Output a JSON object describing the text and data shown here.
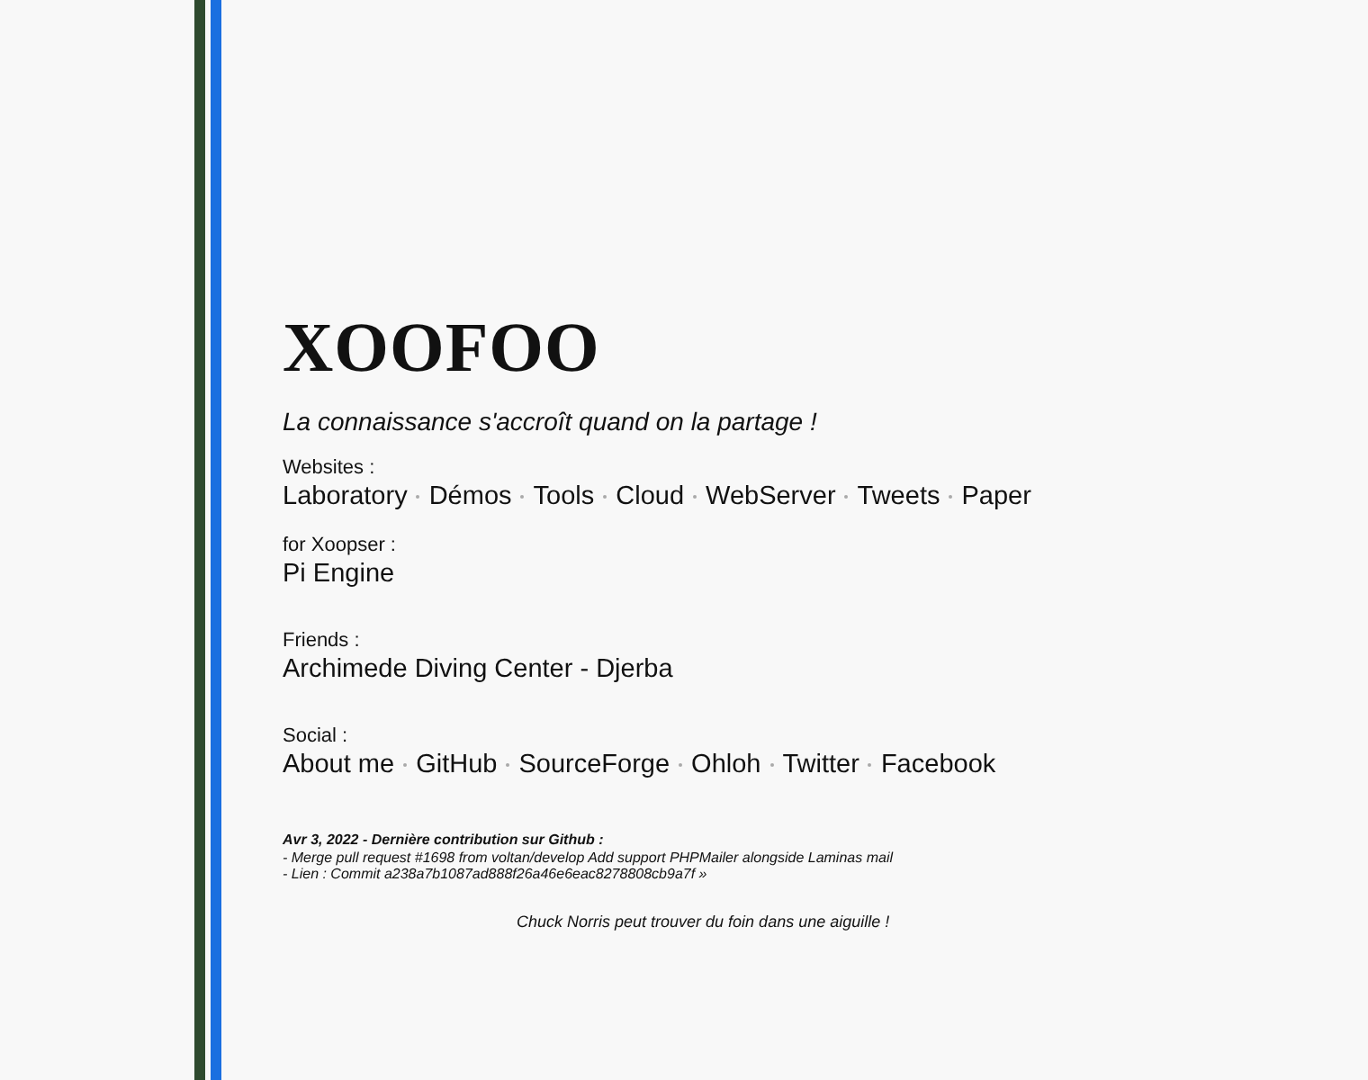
{
  "title": "XOOFOO",
  "tagline": "La connaissance s'accroît quand on la partage !",
  "sections": [
    {
      "label": "Websites :",
      "links": [
        "Laboratory",
        "Démos",
        "Tools",
        "Cloud",
        "WebServer",
        "Tweets",
        "Paper"
      ]
    },
    {
      "label": "for Xoopser :",
      "links": [
        "Pi Engine"
      ]
    },
    {
      "label": "Friends :",
      "links": [
        "Archimede Diving Center - Djerba"
      ]
    },
    {
      "label": "Social :",
      "links": [
        "About me",
        "GitHub",
        "SourceForge",
        "Ohloh",
        "Twitter",
        "Facebook"
      ]
    }
  ],
  "contribution": {
    "heading": "Avr 3, 2022 - Dernière contribution sur Github :",
    "lines": [
      "- Merge pull request #1698 from voltan/develop Add support PHPMailer alongside Laminas mail",
      "- Lien : Commit a238a7b1087ad888f26a46e6eac8278808cb9a7f »"
    ]
  },
  "quote": "Chuck Norris peut trouver du foin dans une aiguille !"
}
